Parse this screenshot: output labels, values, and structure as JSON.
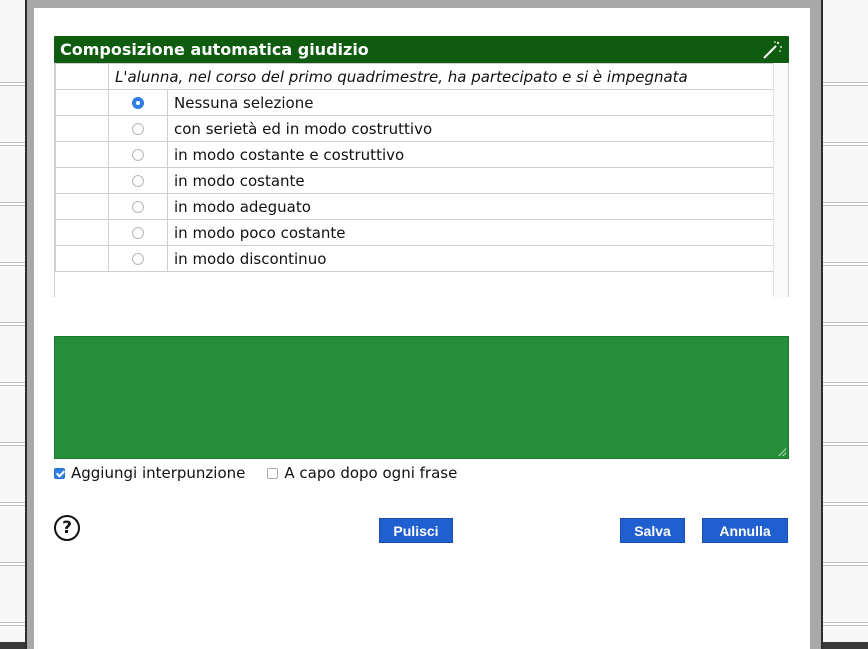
{
  "dialog": {
    "title": "Composizione automatica giudizio",
    "prompt": "L'alunna, nel corso del primo quadrimestre, ha partecipato e si è impegnata",
    "options": [
      {
        "label": "Nessuna selezione",
        "selected": true
      },
      {
        "label": "con serietà ed in modo costruttivo",
        "selected": false
      },
      {
        "label": "in modo costante e costruttivo",
        "selected": false
      },
      {
        "label": "in modo costante",
        "selected": false
      },
      {
        "label": "in modo adeguato",
        "selected": false
      },
      {
        "label": "in modo poco costante",
        "selected": false
      },
      {
        "label": "in modo discontinuo",
        "selected": false
      }
    ],
    "cut_row_text": "... ... ... ...",
    "textarea_value": "",
    "checkbox_punctuation": {
      "label": "Aggiungi interpunzione",
      "checked": true
    },
    "checkbox_newline": {
      "label": "A capo dopo ogni frase",
      "checked": false
    },
    "help_glyph": "?",
    "buttons": {
      "clear": "Pulisci",
      "save": "Salva",
      "cancel": "Annulla"
    }
  },
  "colors": {
    "title_bar": "#0f5b10",
    "textarea": "#268d38",
    "button": "#1f5fcf",
    "radio_selected": "#2f7ee6"
  },
  "icons": {
    "title_action": "magic-wand-icon",
    "help": "help-circle-icon"
  }
}
